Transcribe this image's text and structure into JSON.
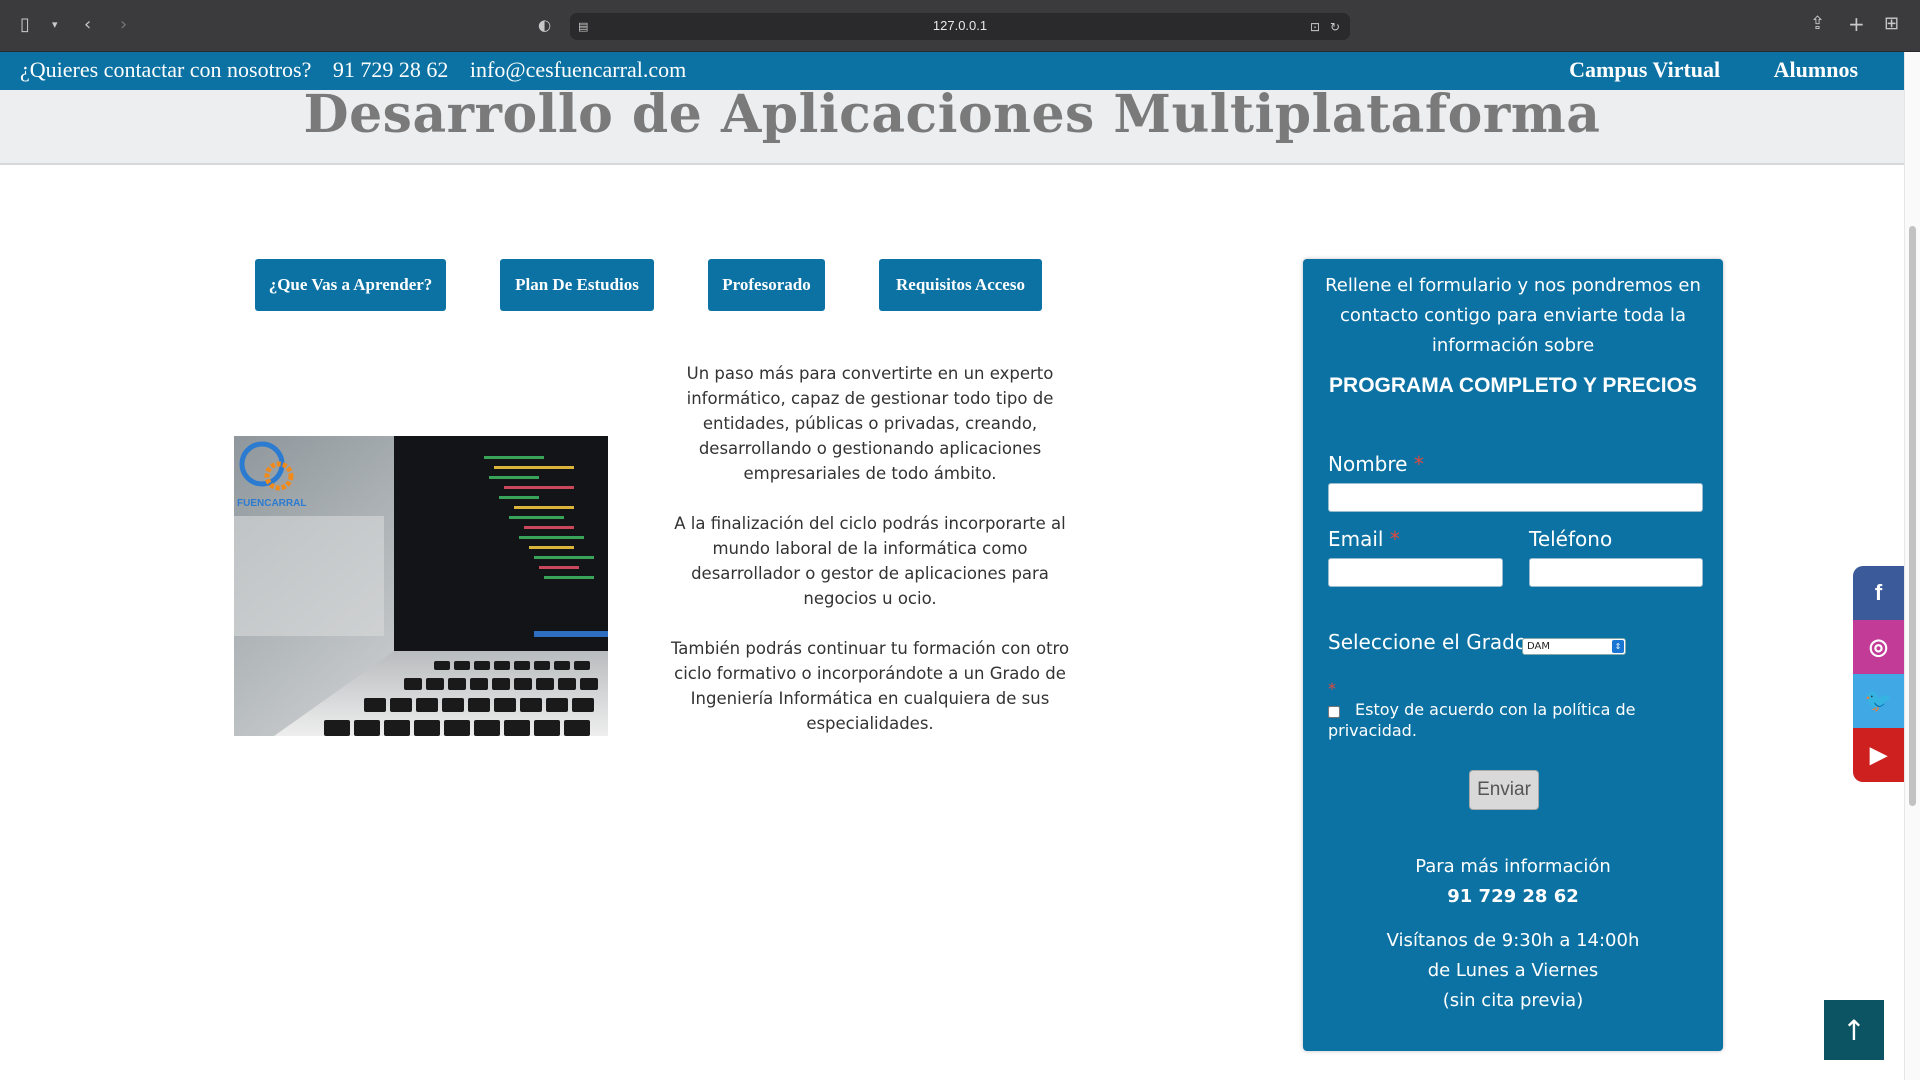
{
  "browser": {
    "url": "127.0.0.1"
  },
  "topbar": {
    "question": "¿Quieres contactar con nosotros?",
    "phone": "91 729 28 62",
    "email": "info@cesfuencarral.com",
    "campus": "Campus Virtual",
    "alumnos": "Alumnos"
  },
  "hero": {
    "title": "Desarrollo de Aplicaciones Multiplataforma"
  },
  "tabs": [
    {
      "label": "¿Que Vas a Aprender?"
    },
    {
      "label": "Plan De Estudios"
    },
    {
      "label": "Profesorado"
    },
    {
      "label": "Requisitos Acceso"
    }
  ],
  "image": {
    "logo_text": "FUENCARRAL"
  },
  "description": {
    "p1": "Un paso más para convertirte en un experto informático, capaz de gestionar todo tipo de entidades, públicas o privadas, creando, desarrollando o gestionando aplicaciones empresariales de todo ámbito.",
    "p2": "A la finalización del ciclo podrás incorporarte al mundo laboral de la informática como desarrollador o gestor de aplicaciones para negocios u ocio.",
    "p3": "También podrás continuar tu formación con otro ciclo formativo o incorporándote a un Grado de Ingeniería Informática en cualquiera de sus especialidades."
  },
  "form": {
    "intro": "Rellene el formulario y nos pondremos en contacto contigo para enviarte toda la información sobre",
    "program": "PROGRAMA COMPLETO Y PRECIOS",
    "name_label": "Nombre",
    "email_label": "Email",
    "phone_label": "Teléfono",
    "required_mark": "*",
    "grade_label": "Seleccione el Grado",
    "grade_value": "DAM",
    "privacy": "Estoy de acuerdo con la política de privacidad.",
    "submit": "Enviar",
    "more_info": "Para más información",
    "more_phone": "91 729 28 62",
    "visit": "Visítanos de 9:30h a 14:00h",
    "days": "de Lunes a Viernes",
    "appointment": "(sin cita previa)"
  },
  "social": {
    "facebook": "f",
    "instagram": "◎",
    "twitter": "🐦",
    "youtube": "▶"
  },
  "to_top": "↑",
  "colors": {
    "brand": "#0c72a3",
    "facebook": "#3b5a9a",
    "instagram": "#c23c97",
    "twitter": "#41a8e6",
    "youtube": "#cd201f"
  }
}
